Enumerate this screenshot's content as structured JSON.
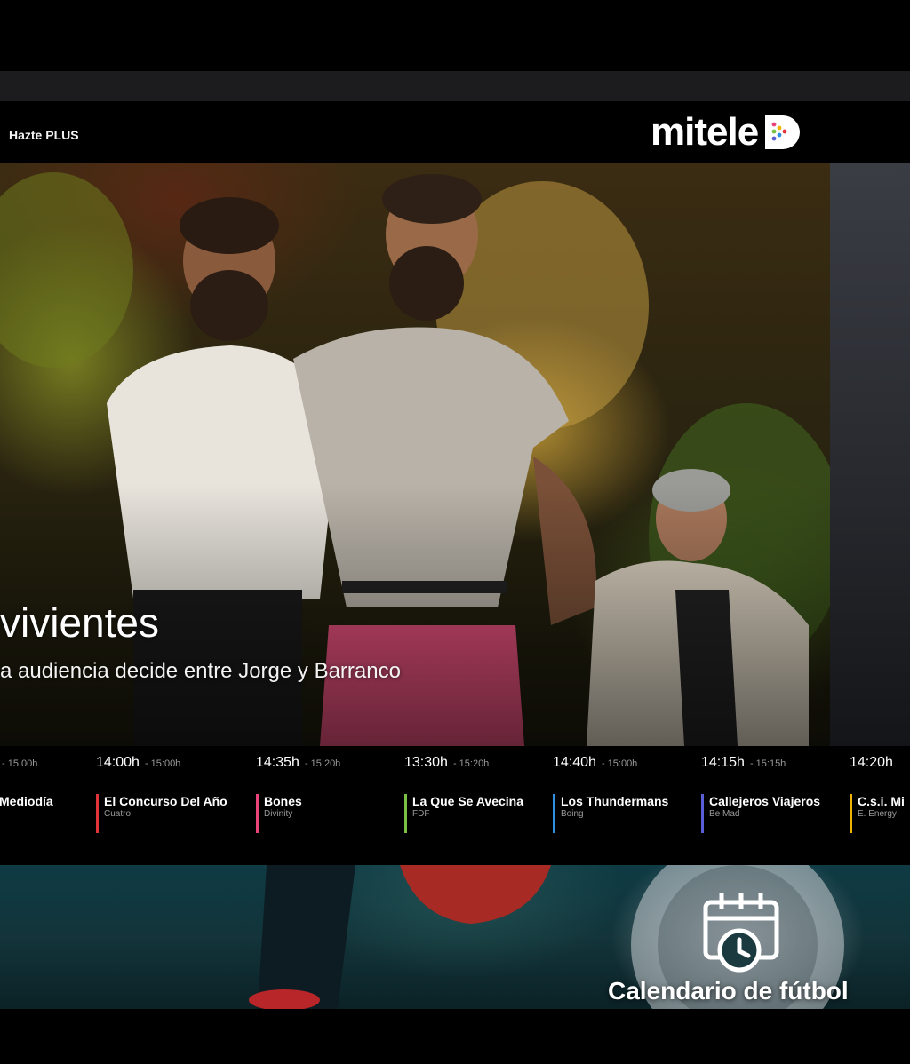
{
  "header": {
    "cta_label": "Hazte PLUS",
    "logo_text": "mitele",
    "brand_color": "#ffffff"
  },
  "hero": {
    "title": "vivientes",
    "subtitle": "a audiencia decide entre Jorge y Barranco"
  },
  "schedule": {
    "slots": [
      {
        "start": "",
        "end": "15:00h",
        "title": "Mediodía",
        "channel": "",
        "color": "#2a6fdb"
      },
      {
        "start": "14:00h",
        "end": "15:00h",
        "title": "El Concurso Del Año",
        "channel": "Cuatro",
        "color": "#e0343a"
      },
      {
        "start": "14:35h",
        "end": "15:20h",
        "title": "Bones",
        "channel": "Divinity",
        "color": "#e8447a"
      },
      {
        "start": "13:30h",
        "end": "15:20h",
        "title": "La Que Se Avecina",
        "channel": "FDF",
        "color": "#7bc043"
      },
      {
        "start": "14:40h",
        "end": "15:00h",
        "title": "Los Thundermans",
        "channel": "Boing",
        "color": "#2f8fe0"
      },
      {
        "start": "14:15h",
        "end": "15:15h",
        "title": "Callejeros Viajeros",
        "channel": "Be Mad",
        "color": "#5b5fd6"
      },
      {
        "start": "14:20h",
        "end": "",
        "title": "C.s.i. Mi",
        "channel": "E. Energy",
        "color": "#f0b400"
      }
    ]
  },
  "football": {
    "label": "Calendario de fútbol",
    "icon": "calendar-clock-icon"
  }
}
